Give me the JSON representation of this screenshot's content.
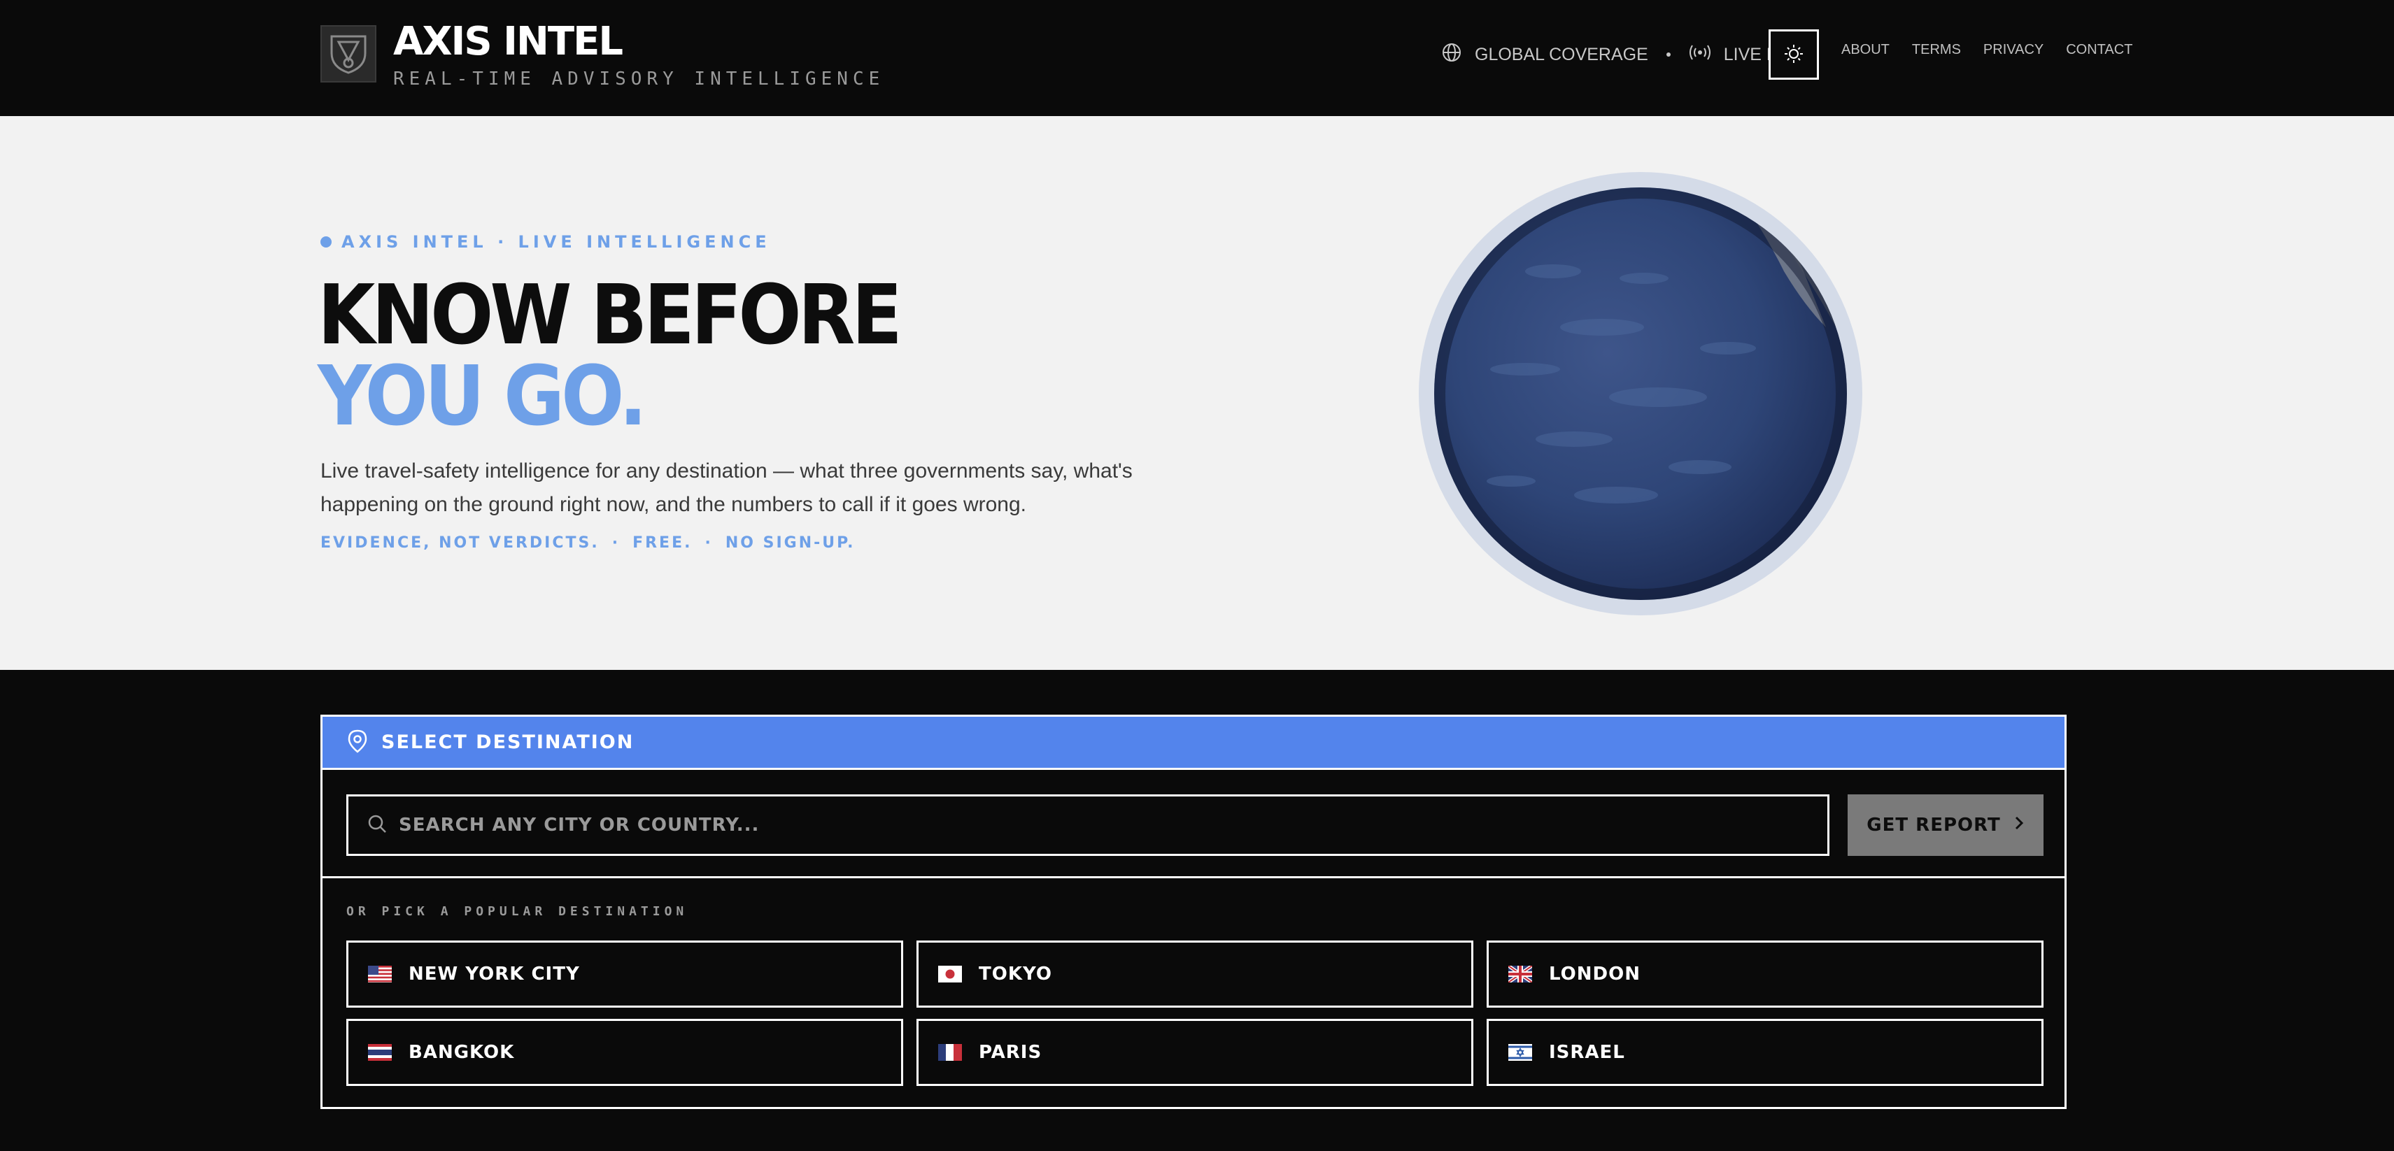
{
  "brand": {
    "title": "AXIS INTEL",
    "subtitle": "REAL-TIME ADVISORY INTELLIGENCE",
    "logo_icon": "shield-badge-icon"
  },
  "header": {
    "coverage_label": "GLOBAL COVERAGE",
    "coverage_icon": "globe-icon",
    "live_label": "LIVE DATA",
    "live_icon": "broadcast-icon",
    "theme_icon": "sun-icon",
    "nav": [
      "ABOUT",
      "TERMS",
      "PRIVACY",
      "CONTACT"
    ]
  },
  "hero": {
    "eyebrow": "AXIS INTEL · LIVE INTELLIGENCE",
    "headline_line1": "KNOW BEFORE",
    "headline_line2": "YOU GO.",
    "description": "Live travel-safety intelligence for any destination — what three governments say, what's happening on the ground right now, and the numbers to call if it goes wrong.",
    "tagline": [
      "EVIDENCE, NOT VERDICTS.",
      "FREE.",
      "NO SIGN-UP."
    ],
    "tagline_sep": "·"
  },
  "destination_panel": {
    "title": "SELECT DESTINATION",
    "title_icon": "map-pin-icon",
    "search": {
      "placeholder": "SEARCH ANY CITY OR COUNTRY...",
      "value": "",
      "icon": "search-icon"
    },
    "report_button": {
      "label": "GET REPORT",
      "icon": "chevron-right-icon"
    },
    "popular_label": "OR PICK A POPULAR DESTINATION",
    "popular": [
      {
        "name": "NEW YORK CITY",
        "flag": "us-flag-icon"
      },
      {
        "name": "TOKYO",
        "flag": "jp-flag-icon"
      },
      {
        "name": "LONDON",
        "flag": "gb-flag-icon"
      },
      {
        "name": "BANGKOK",
        "flag": "th-flag-icon"
      },
      {
        "name": "PARIS",
        "flag": "fr-flag-icon"
      },
      {
        "name": "ISRAEL",
        "flag": "il-flag-icon"
      }
    ]
  },
  "colors": {
    "accent": "#5384ec",
    "accent_light": "#6ea0e8",
    "bg_dark": "#0a0a0a",
    "bg_light": "#f2f2f2",
    "button_gray": "#7a7a7a"
  }
}
